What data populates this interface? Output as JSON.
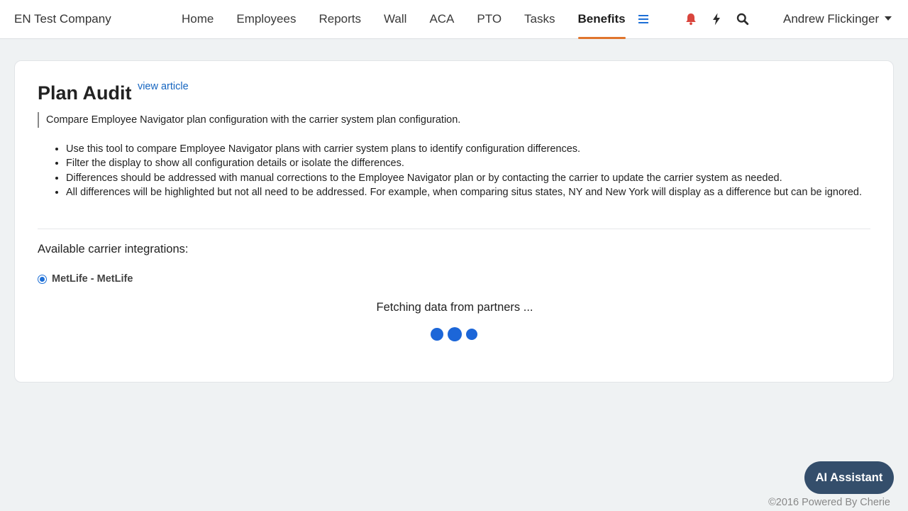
{
  "header": {
    "company": "EN Test Company",
    "nav": [
      {
        "label": "Home",
        "active": false
      },
      {
        "label": "Employees",
        "active": false
      },
      {
        "label": "Reports",
        "active": false
      },
      {
        "label": "Wall",
        "active": false
      },
      {
        "label": "ACA",
        "active": false
      },
      {
        "label": "PTO",
        "active": false
      },
      {
        "label": "Tasks",
        "active": false
      },
      {
        "label": "Benefits",
        "active": true
      }
    ],
    "icons": [
      "menu-icon",
      "bell-icon",
      "lightning-icon",
      "search-icon"
    ],
    "user_name": "Andrew Flickinger"
  },
  "main": {
    "title": "Plan Audit",
    "view_article": "view article",
    "description": "Compare Employee Navigator plan configuration with the carrier system plan configuration.",
    "bullets": [
      "Use this tool to compare Employee Navigator plans with carrier system plans to identify configuration differences.",
      "Filter the display to show all configuration details or isolate the differences.",
      "Differences should be addressed with manual corrections to the Employee Navigator plan or by contacting the carrier to update the carrier system as needed.",
      "All differences will be highlighted but not all need to be addressed. For example, when comparing situs states, NY and New York will display as a difference but can be ignored."
    ],
    "available_label": "Available carrier integrations:",
    "carrier_option": {
      "label": "MetLife - MetLife",
      "selected": true
    },
    "status": "Fetching data from partners ..."
  },
  "ai_assistant": "AI Assistant",
  "footer": "©2016 Powered By Cherie",
  "colors": {
    "accent": "#1d6fd6",
    "active_tab_underline": "#e0752d",
    "bell": "#d9453d",
    "ai_button": "#344e6b",
    "background": "#eff2f3"
  }
}
